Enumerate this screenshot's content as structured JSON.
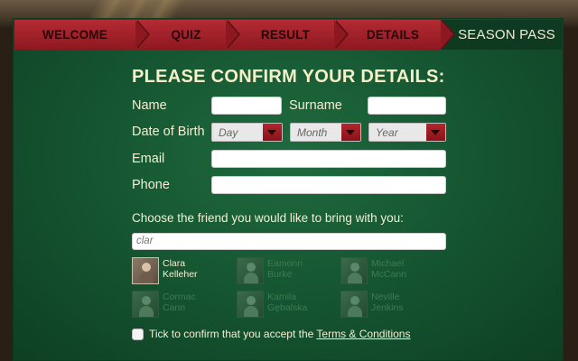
{
  "tabs": [
    {
      "label": "WELCOME"
    },
    {
      "label": "QUIZ"
    },
    {
      "label": "RESULT"
    },
    {
      "label": "DETAILS"
    },
    {
      "label": "SEASON PASS"
    }
  ],
  "form": {
    "title": "PLEASE CONFIRM YOUR DETAILS:",
    "name_label": "Name",
    "surname_label": "Surname",
    "dob_label": "Date of Birth",
    "day": "Day",
    "month": "Month",
    "year": "Year",
    "email_label": "Email",
    "phone_label": "Phone",
    "name_value": "",
    "surname_value": "",
    "email_value": "",
    "phone_value": ""
  },
  "friends": {
    "prompt": "Choose the friend you would like to bring with you:",
    "search_value": "clar",
    "list": [
      {
        "first": "Clara",
        "last": "Kelleher",
        "selected": true
      },
      {
        "first": "Eamonn",
        "last": "Burke",
        "selected": false
      },
      {
        "first": "Michael",
        "last": "McCann",
        "selected": false
      },
      {
        "first": "Cormac",
        "last": "Cann",
        "selected": false
      },
      {
        "first": "Kamila",
        "last": "Gębalska",
        "selected": false
      },
      {
        "first": "Neville",
        "last": "Jenkins",
        "selected": false
      }
    ]
  },
  "terms": {
    "text": "Tick to confirm that you accept the ",
    "link": "Terms & Conditions"
  }
}
